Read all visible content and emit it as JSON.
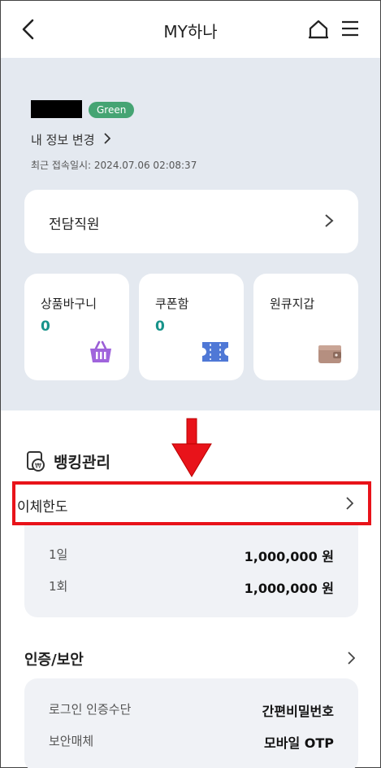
{
  "header": {
    "title": "MY하나"
  },
  "profile": {
    "grade": "Green",
    "info_link": "내 정보 변경",
    "last_login": "최근 접속일시: 2024.07.06 02:08:37"
  },
  "dedicated": {
    "label": "전담직원"
  },
  "tiles": [
    {
      "label": "상품바구니",
      "count": "0",
      "icon": "basket-icon"
    },
    {
      "label": "쿠폰함",
      "count": "0",
      "icon": "coupon-icon"
    },
    {
      "label": "원큐지갑",
      "count": "",
      "icon": "wallet-icon"
    }
  ],
  "banking": {
    "title": "뱅킹관리",
    "limit_label": "이체한도",
    "rows": [
      {
        "k": "1일",
        "v": "1,000,000 원"
      },
      {
        "k": "1회",
        "v": "1,000,000 원"
      }
    ]
  },
  "auth": {
    "title": "인증/보안",
    "rows": [
      {
        "k": "로그인 인증수단",
        "v": "간편비밀번호"
      },
      {
        "k": "보안매체",
        "v": "모바일 OTP"
      }
    ]
  },
  "colors": {
    "accent_teal": "#17938a",
    "badge_green": "#45a473",
    "highlight_red": "#e8131a",
    "background": "#e4e9f0"
  }
}
